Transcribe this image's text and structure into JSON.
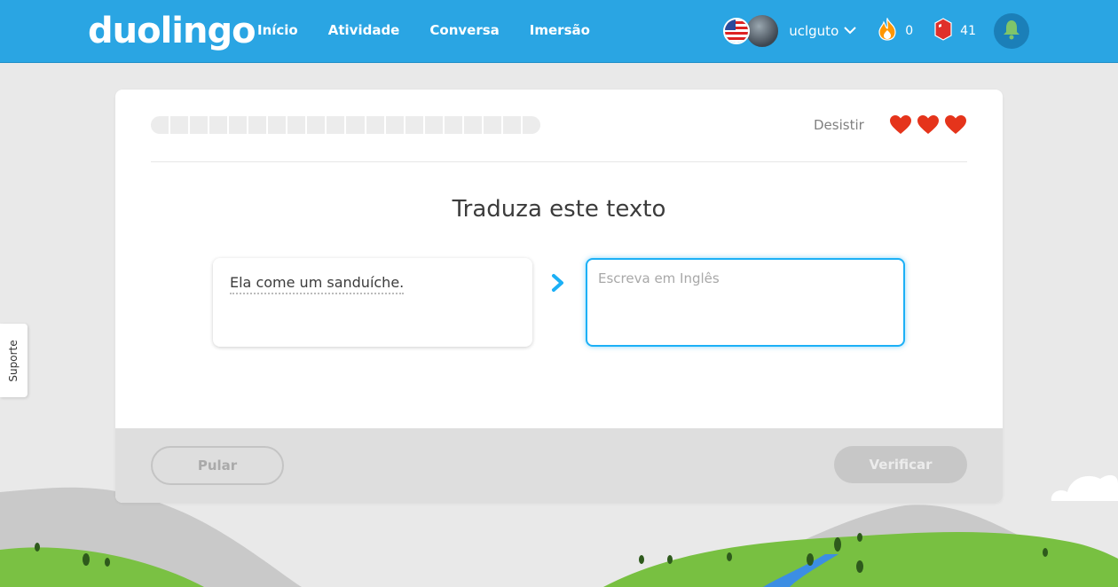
{
  "header": {
    "logo": "duolingo",
    "nav": [
      "Início",
      "Atividade",
      "Conversa",
      "Imersão"
    ],
    "username": "uclguto",
    "streak": "0",
    "lingots": "41"
  },
  "lesson": {
    "quit_label": "Desistir",
    "hearts": 3,
    "progress_segments": 20,
    "progress_fraction": 0,
    "prompt_title": "Traduza este texto",
    "source_sentence": "Ela come um sanduíche.",
    "answer_placeholder": "Escreva em Inglês",
    "skip_label": "Pular",
    "check_label": "Verificar"
  },
  "support_label": "Suporte",
  "colors": {
    "header": "#2aa5e3",
    "heart": "#e5341b",
    "input_border": "#1cb0f6"
  }
}
